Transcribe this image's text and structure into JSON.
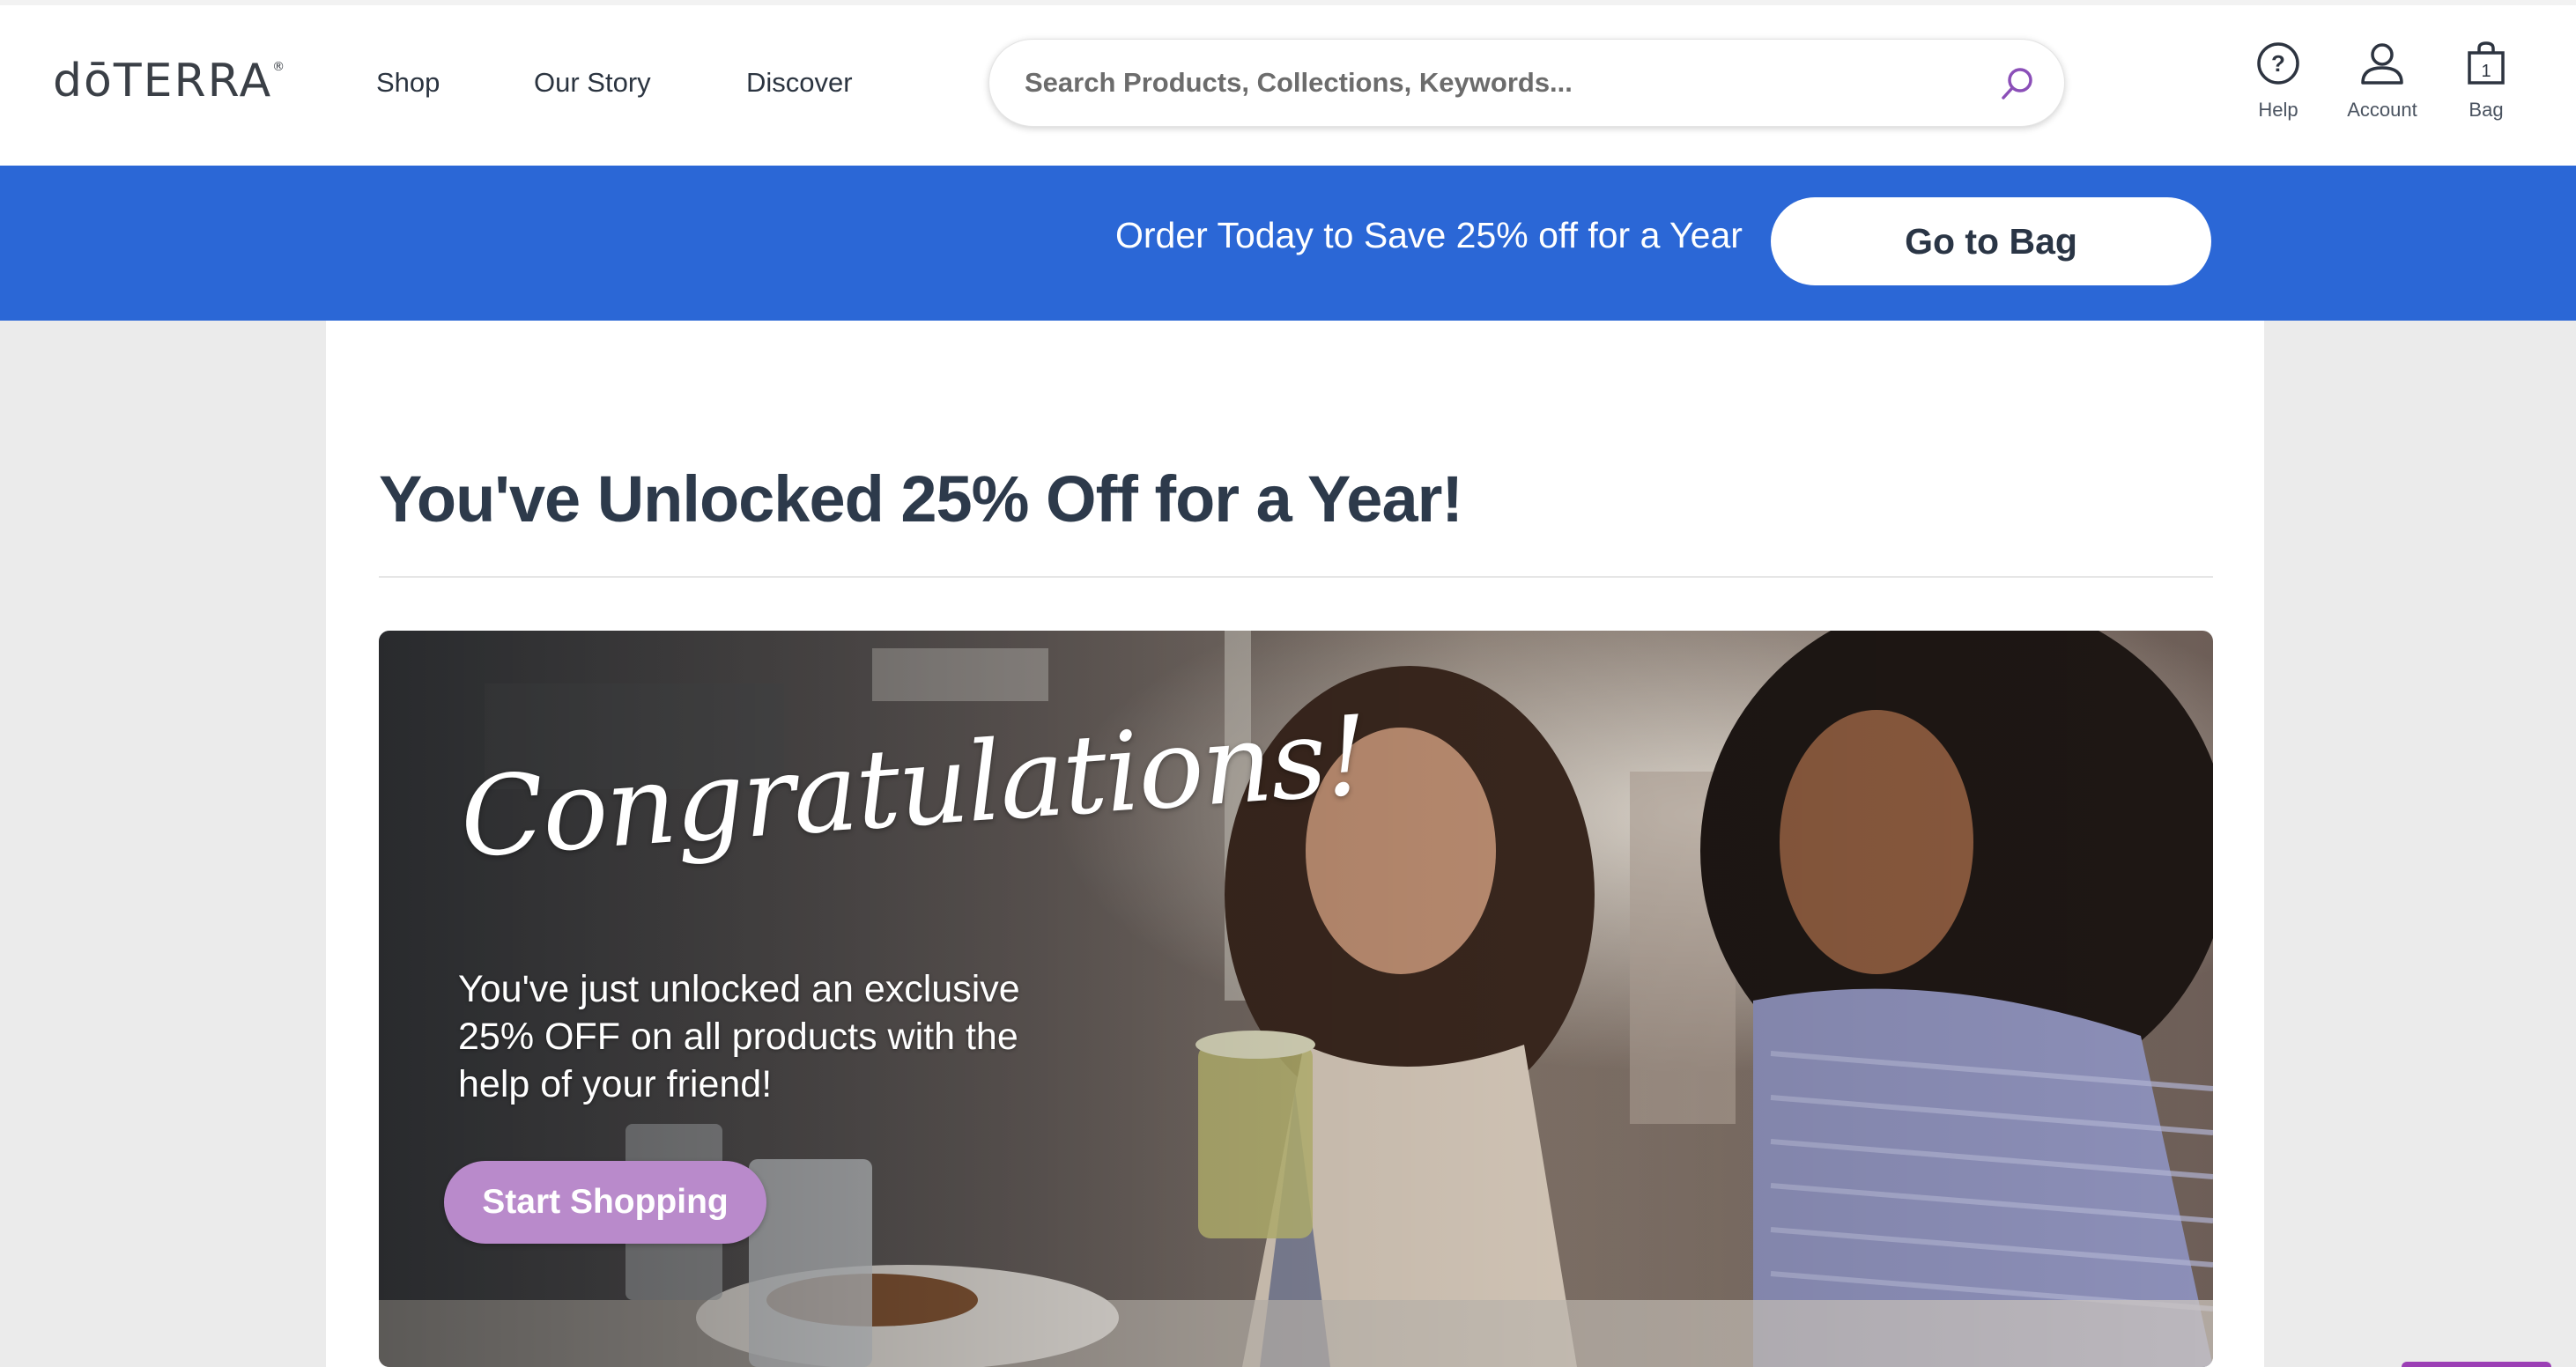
{
  "header": {
    "logo": "dōTERRA",
    "logo_mark": "®",
    "nav": [
      "Shop",
      "Our Story",
      "Discover"
    ],
    "search_placeholder": "Search Products, Collections, Keywords...",
    "utilities": {
      "help": "Help",
      "account": "Account",
      "bag": "Bag",
      "bag_count": "1"
    }
  },
  "banner": {
    "text": "Order Today to Save 25% off for a Year",
    "button": "Go to Bag"
  },
  "main": {
    "title": "You've Unlocked 25% Off for a Year!",
    "hero": {
      "script_heading": "Congratulations!",
      "body": "You've just unlocked an exclusive\n25% OFF on all products with the\nhelp of your friend!",
      "button": "Start Shopping"
    }
  },
  "colors": {
    "banner_blue": "#2b67d6",
    "hero_button": "#b98acb",
    "search_icon": "#8b4fb8",
    "title_text": "#2d3a4b"
  },
  "icons": {
    "search": "search-icon",
    "help": "help-icon",
    "account": "account-icon",
    "bag": "bag-icon"
  }
}
